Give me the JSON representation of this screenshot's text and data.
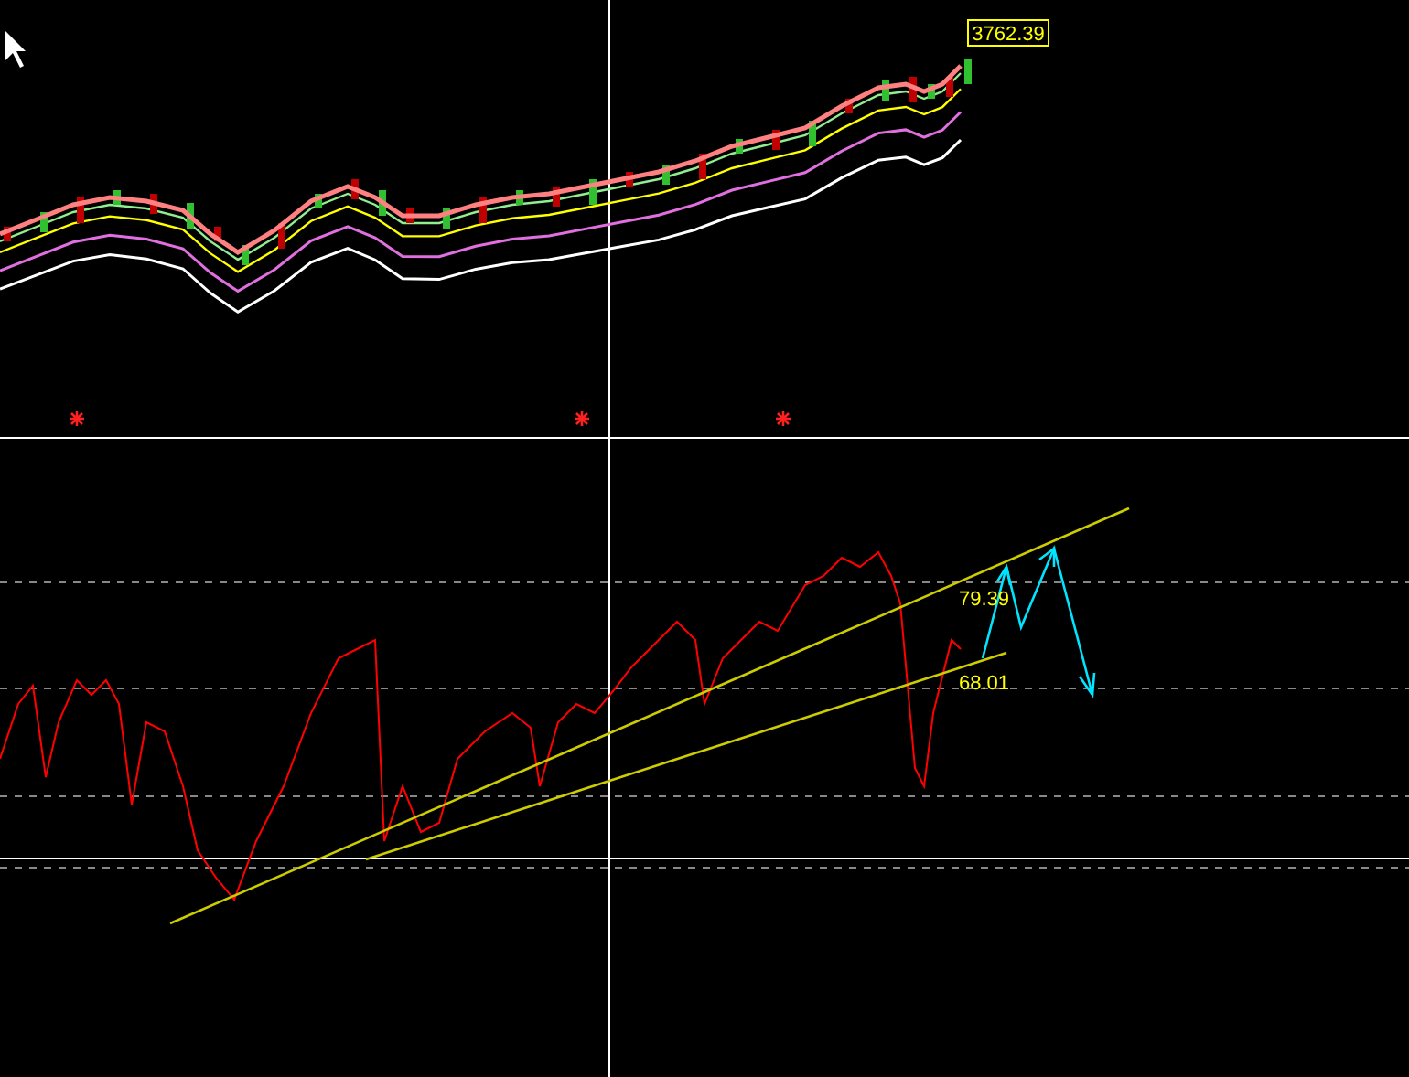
{
  "price_chart": {
    "last_price_tag": "3762.39"
  },
  "oscillator": {
    "level_labels": [
      {
        "label": "79.39"
      },
      {
        "label": "68.01"
      }
    ]
  }
}
